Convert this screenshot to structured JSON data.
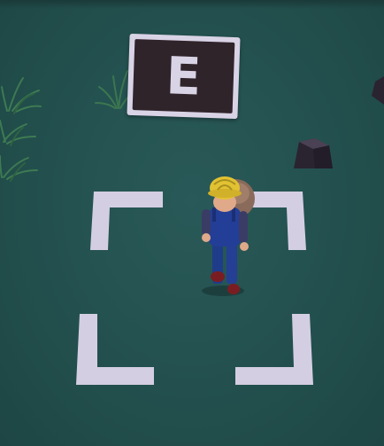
{
  "scene": {
    "type": "top-down game view",
    "ground_color": "#245250",
    "marker_color": "#d4cee2"
  },
  "sign": {
    "letter": "E",
    "board_color": "#d9d3e6",
    "panel_color": "#2f2429"
  },
  "entities": {
    "player": "worker-with-hardhat",
    "objects": [
      "rock",
      "grass-tuft",
      "grass-tuft",
      "grass-tuft"
    ]
  }
}
